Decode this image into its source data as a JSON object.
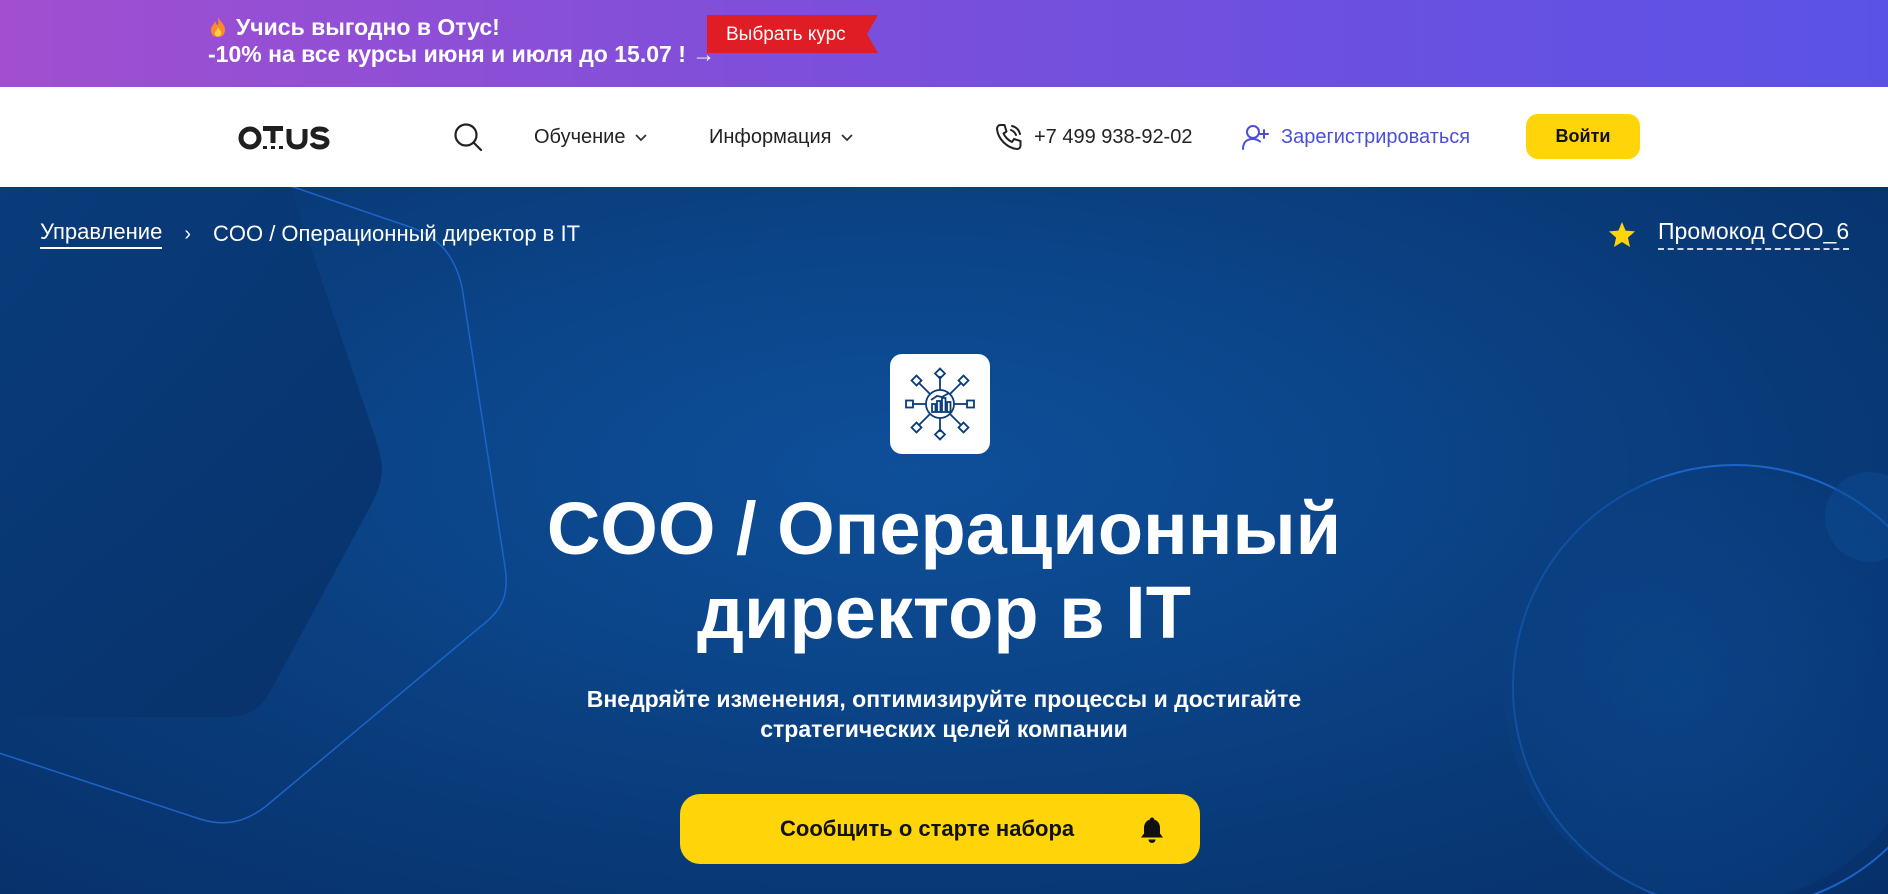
{
  "promo": {
    "line1": "Учись выгодно в Отус!",
    "line2": "-10% на все курсы июня и июля до 15.07 ! →",
    "button_label": "Выбрать курс"
  },
  "header": {
    "logo_text": "otus",
    "nav": {
      "learning": "Обучение",
      "info": "Информация"
    },
    "phone": "+7 499 938-92-02",
    "register": "Зарегистрироваться",
    "login": "Войти"
  },
  "hero": {
    "breadcrumb": {
      "parent": "Управление",
      "current": "COO / Операционный директор в IT"
    },
    "promocode": "Промокод COO_6",
    "title_line1": "COO / Операционный",
    "title_line2": "директор в IT",
    "subtitle_line1": "Внедряйте изменения, оптимизируйте процессы и достигайте",
    "subtitle_line2": "стратегических целей компании",
    "cta": "Сообщить о старте набора"
  },
  "colors": {
    "accent_yellow": "#ffd50a",
    "hero_blue": "#0a3d7c",
    "register_purple": "#4b4fd8",
    "promo_red": "#e01c24"
  }
}
